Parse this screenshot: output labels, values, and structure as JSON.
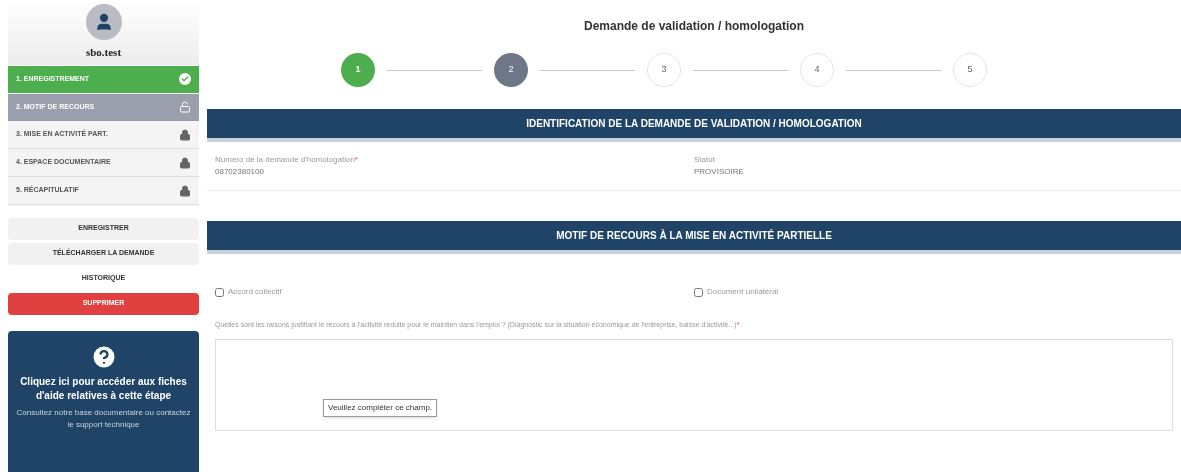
{
  "user": {
    "name": "sbo.test"
  },
  "sidebar": {
    "items": [
      {
        "label": "1. ENREGISTREMENT",
        "done": true,
        "selected": false
      },
      {
        "label": "2. MOTIF DE RECOURS",
        "done": false,
        "selected": true
      },
      {
        "label": "3. MISE EN ACTIVITÉ PART.",
        "done": false,
        "selected": false
      },
      {
        "label": "4. ESPACE DOCUMENTAIRE",
        "done": false,
        "selected": false
      },
      {
        "label": "5. RÉCAPITULATIF",
        "done": false,
        "selected": false
      }
    ]
  },
  "actions": [
    {
      "label": "ENREGISTRER",
      "kind": "default"
    },
    {
      "label": "TÉLÉCHARGER LA DEMANDE",
      "kind": "default"
    },
    {
      "label": "HISTORIQUE",
      "kind": "plain"
    },
    {
      "label": "SUPPRIMER",
      "kind": "danger"
    }
  ],
  "help": {
    "title": "Cliquez ici pour accéder aux fiches d'aide relatives à cette étape",
    "note": "Consultez notre base documentaire ou contactez le support technique"
  },
  "page_title": "Demande de validation / homologation",
  "steps": [
    {
      "label": "1",
      "done": true,
      "selected": false
    },
    {
      "label": "2",
      "done": false,
      "selected": true
    },
    {
      "label": "3",
      "done": false,
      "selected": false
    },
    {
      "label": "4",
      "done": false,
      "selected": false
    },
    {
      "label": "5",
      "done": false,
      "selected": false
    }
  ],
  "identification": {
    "title": "IDENTIFICATION DE LA DEMANDE DE VALIDATION / HOMOLOGATION",
    "fields": [
      {
        "label": "Numéro de la demande d'homologation",
        "required_mark": "*",
        "value": "08702380100"
      },
      {
        "label": "Statut",
        "value": "PROVISOIRE"
      }
    ]
  },
  "motif": {
    "title": "MOTIF DE RECOURS À LA MISE EN ACTIVITÉ PARTIELLE",
    "options": [
      {
        "label": "Accord collectif",
        "checked": false
      },
      {
        "label": "Document unilatéral",
        "checked": false
      }
    ],
    "question": {
      "label": "Quelles sont les raisons justifiant le recours à l'activité réduite pour le maintien dans l'emploi ? (Diagnostic sur la situation économique de l'entreprise, baisse d'activité...)",
      "required_mark": "*"
    },
    "tooltip": "Veuillez compléter ce champ."
  }
}
